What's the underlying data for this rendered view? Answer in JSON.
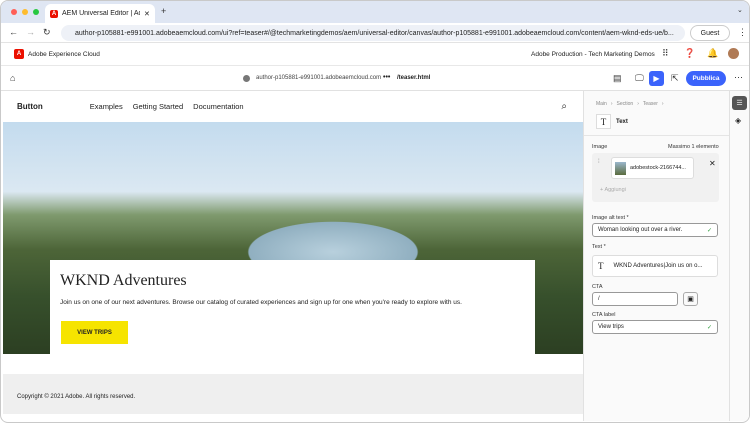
{
  "browser": {
    "tab_title": "AEM Universal Editor | Adobe",
    "url": "author-p105881-e991001.adobeaemcloud.com/ui?ref=teaser#/@techmarketingdemos/aem/universal-editor/canvas/author-p105881-e991001.adobeaemcloud.com/content/aem-wknd-eds-ue/b...",
    "guest": "Guest"
  },
  "aec": {
    "brand": "Adobe Experience Cloud",
    "org": "Adobe Production - Tech Marketing Demos"
  },
  "toolbar": {
    "host": "author-p105881-e991001.adobeaemcloud.com",
    "more": "•••",
    "path": "/teaser.html",
    "publish": "Pubblica"
  },
  "site": {
    "logo": "Button",
    "links": [
      "Examples",
      "Getting Started",
      "Documentation"
    ],
    "card_title": "WKND Adventures",
    "card_text": "Join us on one of our next adventures. Browse our catalog of curated experiences and sign up for one when you're ready to explore with us.",
    "cta": "VIEW TRIPS",
    "copyright": "Copyright © 2021 Adobe. All rights reserved."
  },
  "panel": {
    "breadcrumb": [
      "Main",
      "Section",
      "Teaser"
    ],
    "component": "Text",
    "image_label": "Image",
    "image_max": "Massimo 1 elemento",
    "image_file": "adobestock-2166744...",
    "add": "Aggiungi",
    "alt_label": "Image alt text",
    "alt_value": "Woman looking out over a river.",
    "text_label": "Text",
    "text_value": "WKND Adventures|Join us on o...",
    "cta_label": "CTA",
    "cta_value": "/",
    "cta_label_label": "CTA label",
    "cta_label_value": "View trips"
  },
  "colors": {
    "accent": "#3b63fb",
    "cta": "#f6e400"
  }
}
